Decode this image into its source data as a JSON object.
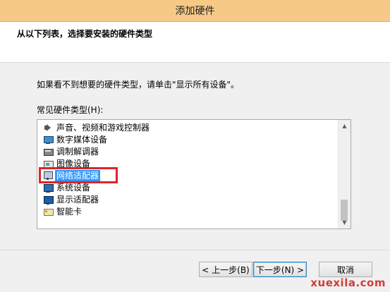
{
  "window": {
    "title": "添加硬件"
  },
  "header": {
    "title": "从以下列表，选择要安装的硬件类型"
  },
  "instructions": "如果看不到想要的硬件类型，请单击\"显示所有设备\"。",
  "list": {
    "label": "常见硬件类型(H):",
    "items": [
      {
        "label": "声音、视频和游戏控制器",
        "icon": "speaker-icon"
      },
      {
        "label": "数字媒体设备",
        "icon": "media-device-icon"
      },
      {
        "label": "调制解调器",
        "icon": "modem-icon"
      },
      {
        "label": "图像设备",
        "icon": "imaging-device-icon"
      },
      {
        "label": "网络适配器",
        "icon": "network-adapter-icon",
        "selected": true
      },
      {
        "label": "系统设备",
        "icon": "system-device-icon"
      },
      {
        "label": "显示适配器",
        "icon": "display-adapter-icon"
      },
      {
        "label": "智能卡",
        "icon": "smart-card-icon"
      }
    ],
    "scroll_up_glyph": "▲",
    "scroll_down_glyph": "▼"
  },
  "buttons": {
    "back": "< 上一步(B)",
    "next": "下一步(N) >",
    "cancel": "取消"
  },
  "colors": {
    "titlebar": "#f7c987",
    "selection": "#3399ff",
    "highlight_box": "#d9262b"
  },
  "watermark": "xuexila.com"
}
